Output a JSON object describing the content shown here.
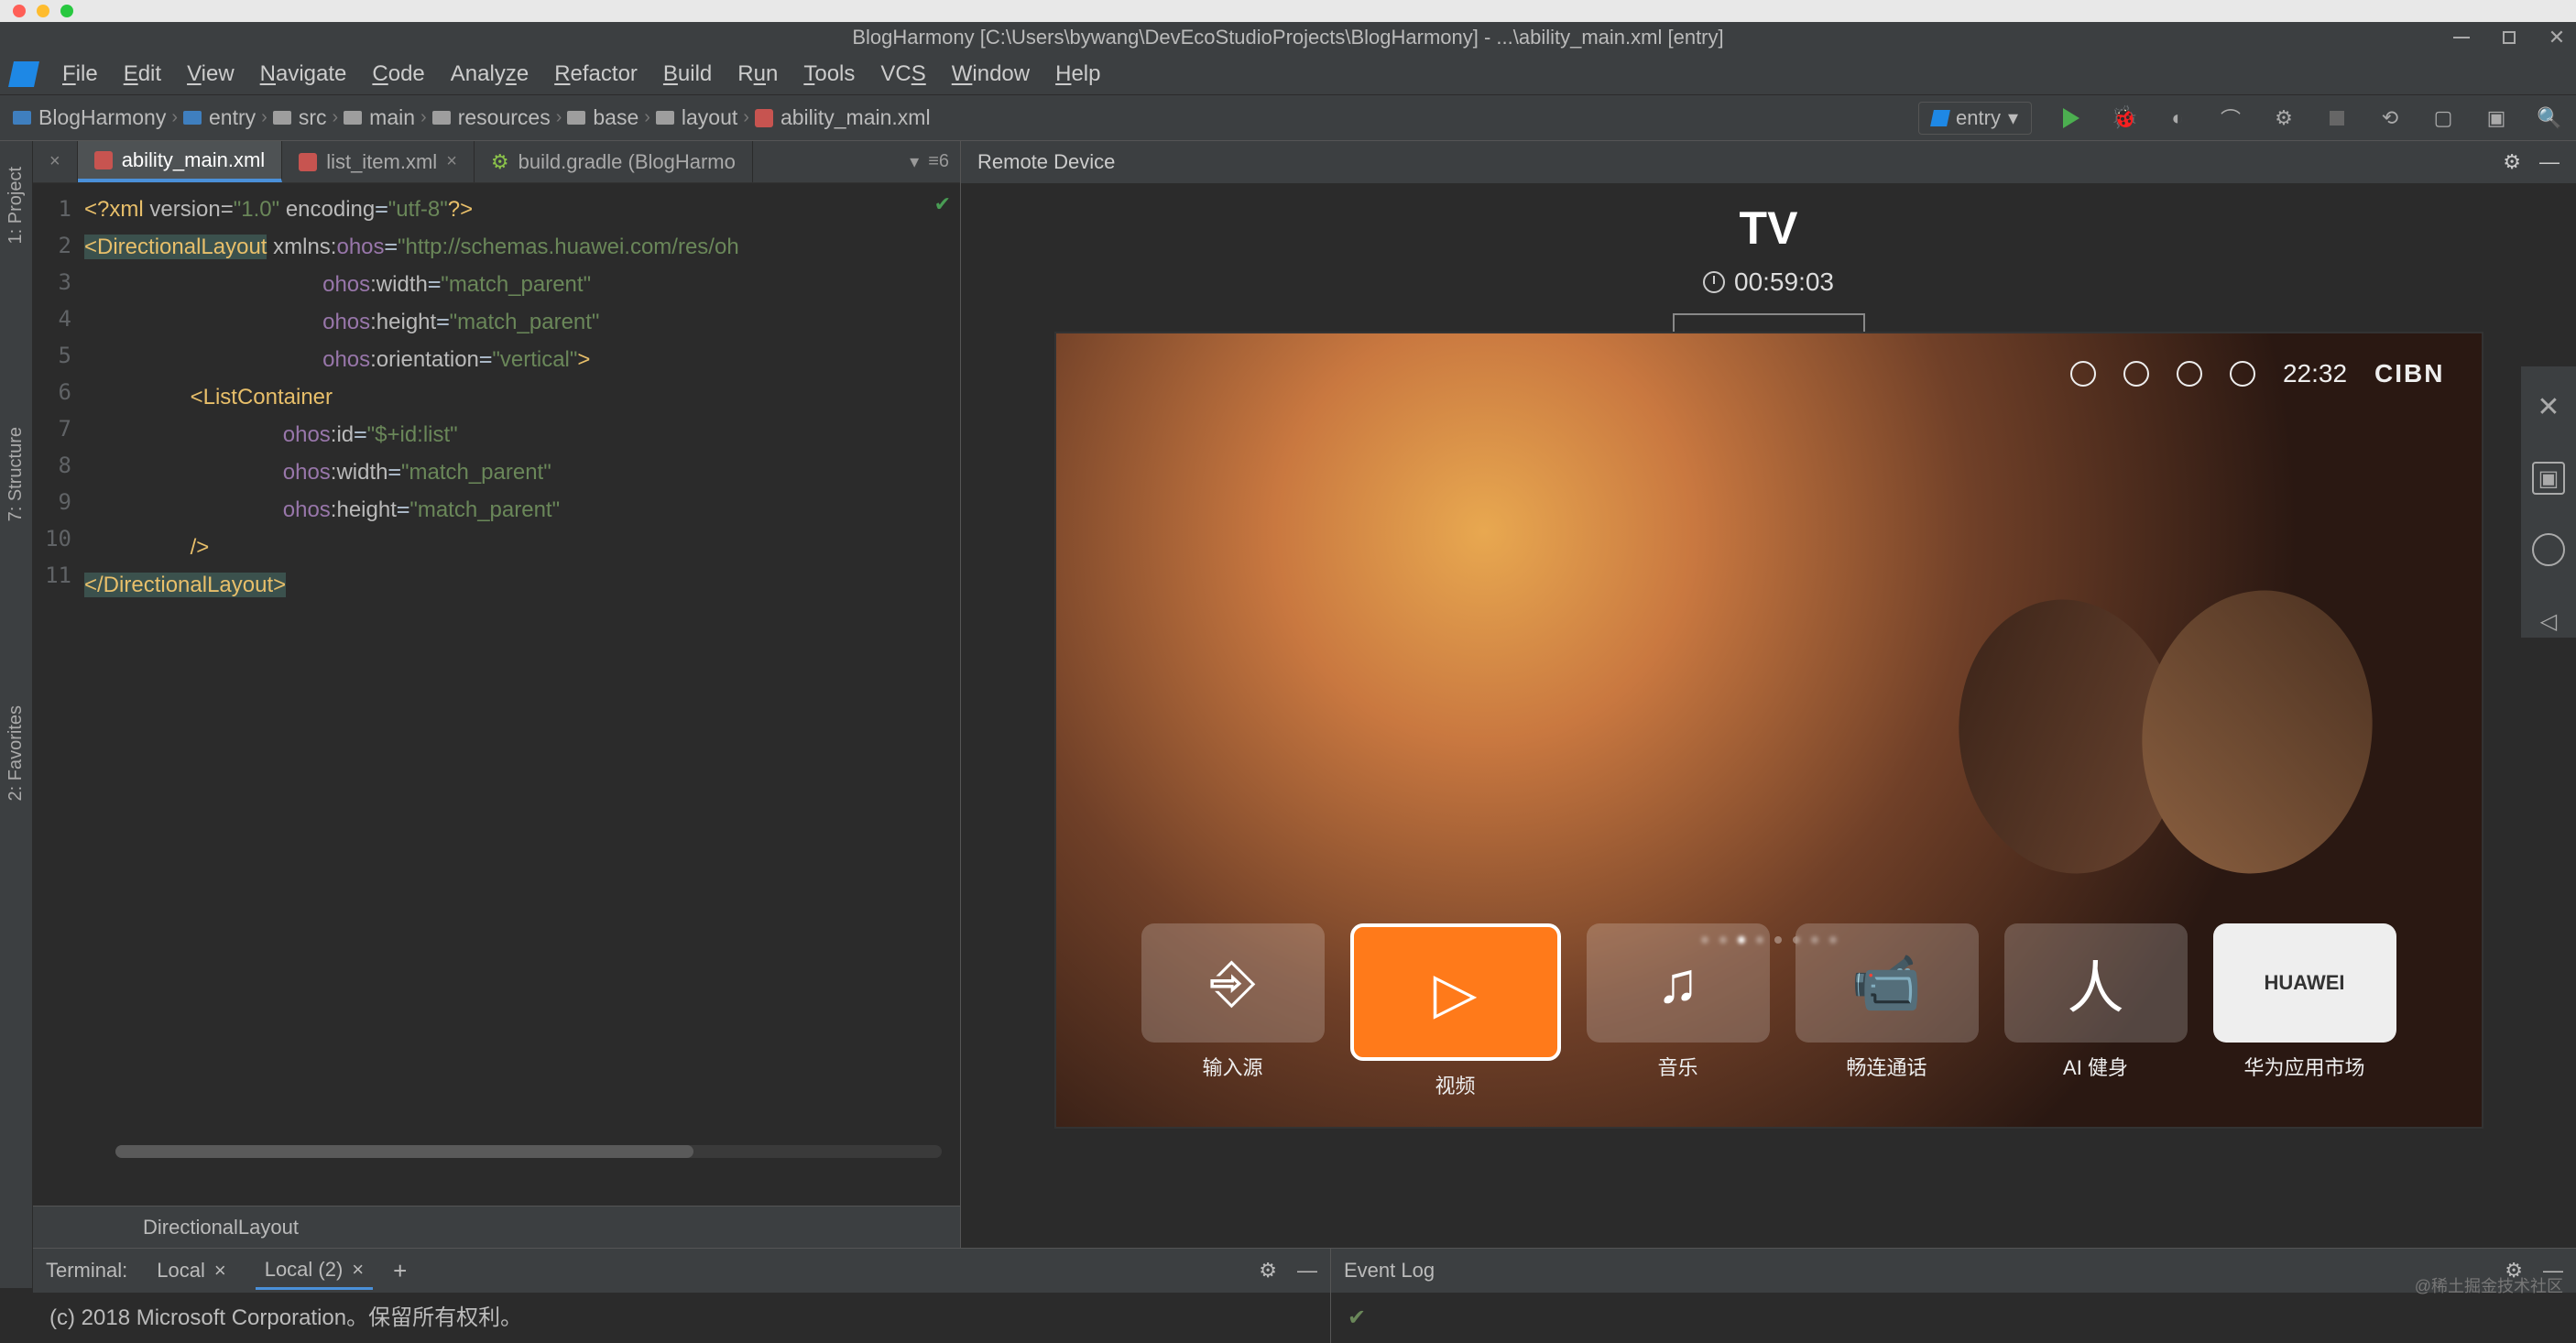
{
  "mac": {
    "title": ""
  },
  "titlebar": {
    "text": "BlogHarmony [C:\\Users\\bywang\\DevEcoStudioProjects\\BlogHarmony] - ...\\ability_main.xml [entry]"
  },
  "menu": [
    "File",
    "Edit",
    "View",
    "Navigate",
    "Code",
    "Analyze",
    "Refactor",
    "Build",
    "Run",
    "Tools",
    "VCS",
    "Window",
    "Help"
  ],
  "breadcrumbs": [
    "BlogHarmony",
    "entry",
    "src",
    "main",
    "resources",
    "base",
    "layout",
    "ability_main.xml"
  ],
  "runConfig": "entry",
  "tabs": [
    {
      "name": "ability_main.xml",
      "active": true,
      "pinned": true
    },
    {
      "name": "list_item.xml",
      "active": false
    },
    {
      "name": "build.gradle (BlogHarmo",
      "active": false
    }
  ],
  "tabExtra": "≡6",
  "code": {
    "lines": [
      1,
      2,
      3,
      4,
      5,
      6,
      7,
      8,
      9,
      10,
      11
    ],
    "l1": {
      "p1": "<?xml ",
      "a1": "version",
      "v1": "\"1.0\"",
      "a2": " encoding",
      "v2": "\"utf-8\"",
      "p2": "?>"
    },
    "l2": {
      "t": "<DirectionalLayout",
      "a": " xmlns:",
      "ns": "ohos",
      "v": "\"http://schemas.huawei.com/res/oh"
    },
    "l3": {
      "ns": "ohos",
      "a": ":width",
      "v": "\"match_parent\""
    },
    "l4": {
      "ns": "ohos",
      "a": ":height",
      "v": "\"match_parent\""
    },
    "l5": {
      "ns": "ohos",
      "a": ":orientation",
      "v": "\"vertical\"",
      "end": ">"
    },
    "l6": {
      "t": "<ListContainer"
    },
    "l7": {
      "ns": "ohos",
      "a": ":id",
      "v": "\"$+id:list\""
    },
    "l8": {
      "ns": "ohos",
      "a": ":width",
      "v": "\"match_parent\""
    },
    "l9": {
      "ns": "ohos",
      "a": ":height",
      "v": "\"match_parent\""
    },
    "l10": {
      "t": "/>"
    },
    "l11": {
      "t": "</DirectionalLayout>"
    }
  },
  "codeStatus": "DirectionalLayout",
  "preview": {
    "header": "Remote Device",
    "title": "TV",
    "timer": "00:59:03",
    "statusbar": {
      "time": "22:32",
      "brand": "CIBN"
    },
    "dock": [
      {
        "label": "输入源",
        "icon": "input"
      },
      {
        "label": "视频",
        "icon": "play",
        "active": true
      },
      {
        "label": "音乐",
        "icon": "music"
      },
      {
        "label": "畅连通话",
        "icon": "videocall"
      },
      {
        "label": "AI 健身",
        "icon": "ai"
      },
      {
        "label": "华为应用市场",
        "icon": "huawei",
        "text": "HUAWEI"
      }
    ]
  },
  "terminal": {
    "title": "Terminal:",
    "tabs": [
      "Local",
      "Local (2)"
    ],
    "activeTab": 1,
    "output": "(c) 2018 Microsoft Corporation。保留所有权利。"
  },
  "eventLog": {
    "title": "Event Log"
  },
  "rails": {
    "project": "1: Project",
    "structure": "7: Structure",
    "favorites": "2: Favorites"
  },
  "watermark": "@稀土掘金技术社区"
}
